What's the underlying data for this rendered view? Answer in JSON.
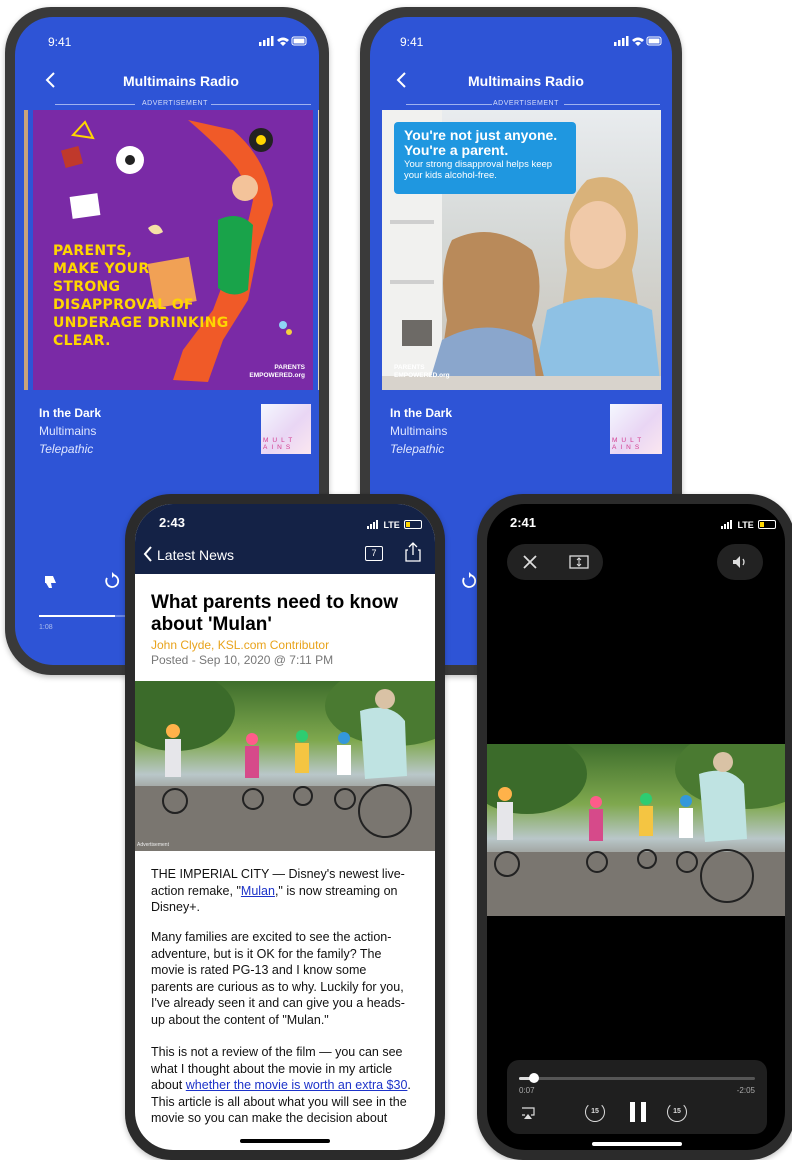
{
  "radio_left": {
    "status_time": "9:41",
    "nav_title": "Multimains Radio",
    "ad_label": "ADVERTISEMENT",
    "poster_headline": [
      "PARENTS,",
      "MAKE YOUR",
      "STRONG",
      "DISAPPROVAL OF",
      "UNDERAGE DRINKING",
      "CLEAR."
    ],
    "brand_logo": "PARENTS EMPOWERED.org",
    "track_title": "In the Dark",
    "artist": "Multimains",
    "album": "Telepathic",
    "thumb_text": "MULT AINS",
    "elapsed": "1:08"
  },
  "radio_right": {
    "status_time": "9:41",
    "nav_title": "Multimains Radio",
    "ad_label": "ADVERTISEMENT",
    "ad_headline_1": "You're not just anyone.",
    "ad_headline_2": "You're a parent.",
    "ad_body": "Your strong disapproval helps keep your kids alcohol-free.",
    "brand_logo": "PARENTS EMPOWERED.org",
    "track_title": "In the Dark",
    "artist": "Multimains",
    "album": "Telepathic",
    "thumb_text": "MULT AINS"
  },
  "news": {
    "status_time": "2:43",
    "network": "LTE",
    "back_label": "Latest News",
    "comment_count": "7",
    "headline": "What parents need to know about 'Mulan'",
    "author": "John Clyde, KSL.com Contributor",
    "posted": "Posted - Sep 10, 2020 @ 7:11 PM",
    "image_caption": "Advertisement",
    "p1_before": "THE IMPERIAL CITY — Disney's newest live-action remake, \"",
    "p1_link": "Mulan",
    "p1_after": ",\" is now streaming on Disney+.",
    "p2": "Many families are excited to see the action-adventure, but is it OK for the family? The movie is rated PG-13 and I know some parents are curious as to why. Luckily for you, I've already seen it and can give you a heads-up about the content of \"Mulan.\"",
    "p3_before": "This is not a review of the film — you can see what I thought about the movie in my article about ",
    "p3_link": "whether the movie is worth an extra $30",
    "p3_after": ". This article is all about what you will see in the movie so you can make the decision about"
  },
  "video": {
    "status_time": "2:41",
    "network": "LTE",
    "elapsed": "0:07",
    "remaining": "-2:05",
    "skip_seconds": "15",
    "progress": 0.05
  }
}
